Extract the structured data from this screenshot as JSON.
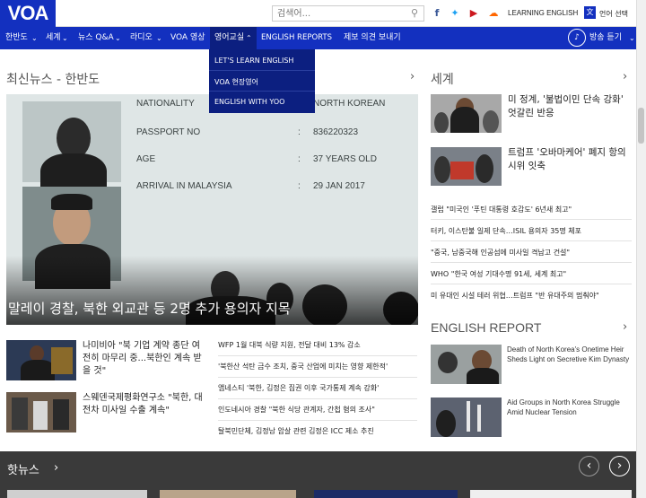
{
  "header": {
    "logo": "VOA",
    "search_placeholder": "검색어...",
    "learn_english": "LEARNING ENGLISH",
    "language_select": "언어 선택",
    "social_icons": [
      "facebook-icon",
      "twitter-icon",
      "youtube-icon",
      "podcast-icon"
    ]
  },
  "nav": {
    "items": [
      "한반도",
      "세계",
      "뉴스 Q&A",
      "라디오",
      "VOA 영상",
      "영어교실",
      "ENGLISH REPORTS",
      "제보 의견 보내기"
    ],
    "listen": "방송 듣기",
    "dropdown": [
      "LET'S LEARN ENGLISH",
      "VOA 현장영어",
      "ENGLISH WITH YOO"
    ]
  },
  "main": {
    "section_title": "최신뉴스 - 한반도",
    "hero": {
      "caption": "말레이 경찰, 북한 외교관 등 2명 추가 용의자 지목",
      "doc_labels": [
        "NATIONALITY",
        "PASSPORT NO",
        "AGE",
        "ARRIVAL IN MALAYSIA"
      ],
      "doc_values": [
        "NORTH KOREAN",
        "836220323",
        "37 YEARS OLD",
        "29 JAN 2017"
      ]
    },
    "stories": [
      "나미비아 \"북 기업 계약 종단 여전히 마무리 중...북한인 계속 받을 것\"",
      "스웨덴국제평화연구소 \"북한, 대전차 미사일 수출 계속\""
    ],
    "headlines": [
      "WFP 1월 대북 식량 지원, 전달 대비 13% 감소",
      "'북한산 석탄 금수 조치, 중국 산업에 미치는 영향 제한적'",
      "앰네스티 '북한, 김정은 집권 이후 국가통제 계속 강화'",
      "인도네시아 경찰 \"북한 식당 관계자, 간첩 혐의 조사\"",
      "탈북민단체, 김정남 암살 관련 김정은 ICC 제소 추진"
    ]
  },
  "world": {
    "title": "세계",
    "featured": [
      "미 정계, '불법이민 단속 강화' 엇갈린 반응",
      "트럼프 '오바마케어' 폐지 항의 시위 잇축"
    ],
    "headlines": [
      "갤럽 \"미국인 '푸틴 대통령 호감도' 6년새 최고\"",
      "터키, 이스탄불 일제 단속…ISIL 용의자 35명 체포",
      "\"중국, 남중국해 인공섬에 미사일 격납고 건설\"",
      "WHO \"한국 여성 기대수명 91세, 세계 최고\"",
      "미 유대인 시설 테러 위협…트럼프 \"반 유대주의 멈춰야\""
    ]
  },
  "english_report": {
    "title": "ENGLISH REPORT",
    "items": [
      "Death of North Korea's Onetime Heir Sheds Light on Secretive Kim Dynasty",
      "Aid Groups in North Korea Struggle Amid Nuclear Tension"
    ]
  },
  "hot": {
    "title": "핫뉴스",
    "prev": "‹",
    "next": "›"
  },
  "colors": {
    "brand": "#1330bf",
    "nav_active": "#0c1f80",
    "dark_band": "#3a3a3a"
  }
}
